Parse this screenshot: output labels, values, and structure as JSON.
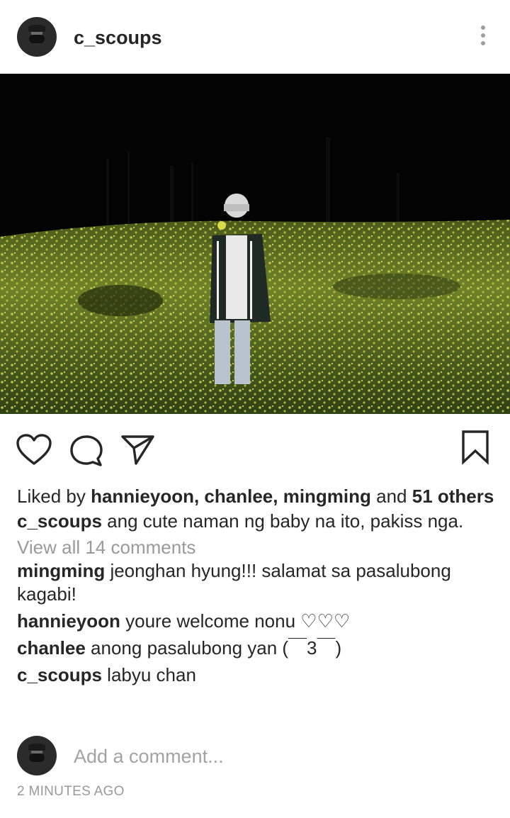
{
  "post": {
    "username": "c_scoups",
    "liked_prefix": "Liked by ",
    "liked_names": "hannieyoon, chanlee, mingming",
    "liked_and": " and ",
    "liked_count": "51",
    "liked_suffix": " others",
    "caption_user": "c_scoups",
    "caption_text": " ang cute naman ng baby na ito, pakiss nga.",
    "view_all": "View all 14 comments",
    "comments": [
      {
        "user": "mingming",
        "text": " jeonghan hyung!!! salamat sa pasalubong kagabi!"
      },
      {
        "user": "hannieyoon",
        "text": " youre welcome nonu ♡♡♡"
      },
      {
        "user": "chanlee",
        "text": " anong pasalubong yan (￣3￣)"
      },
      {
        "user": "c_scoups",
        "text": " labyu chan"
      }
    ],
    "add_comment_placeholder": "Add a comment...",
    "timestamp": "2 MINUTES AGO"
  },
  "icons": {
    "more": "more-vertical-icon",
    "like": "heart-outline-icon",
    "comment": "comment-bubble-icon",
    "share": "paper-plane-icon",
    "save": "bookmark-outline-icon"
  }
}
